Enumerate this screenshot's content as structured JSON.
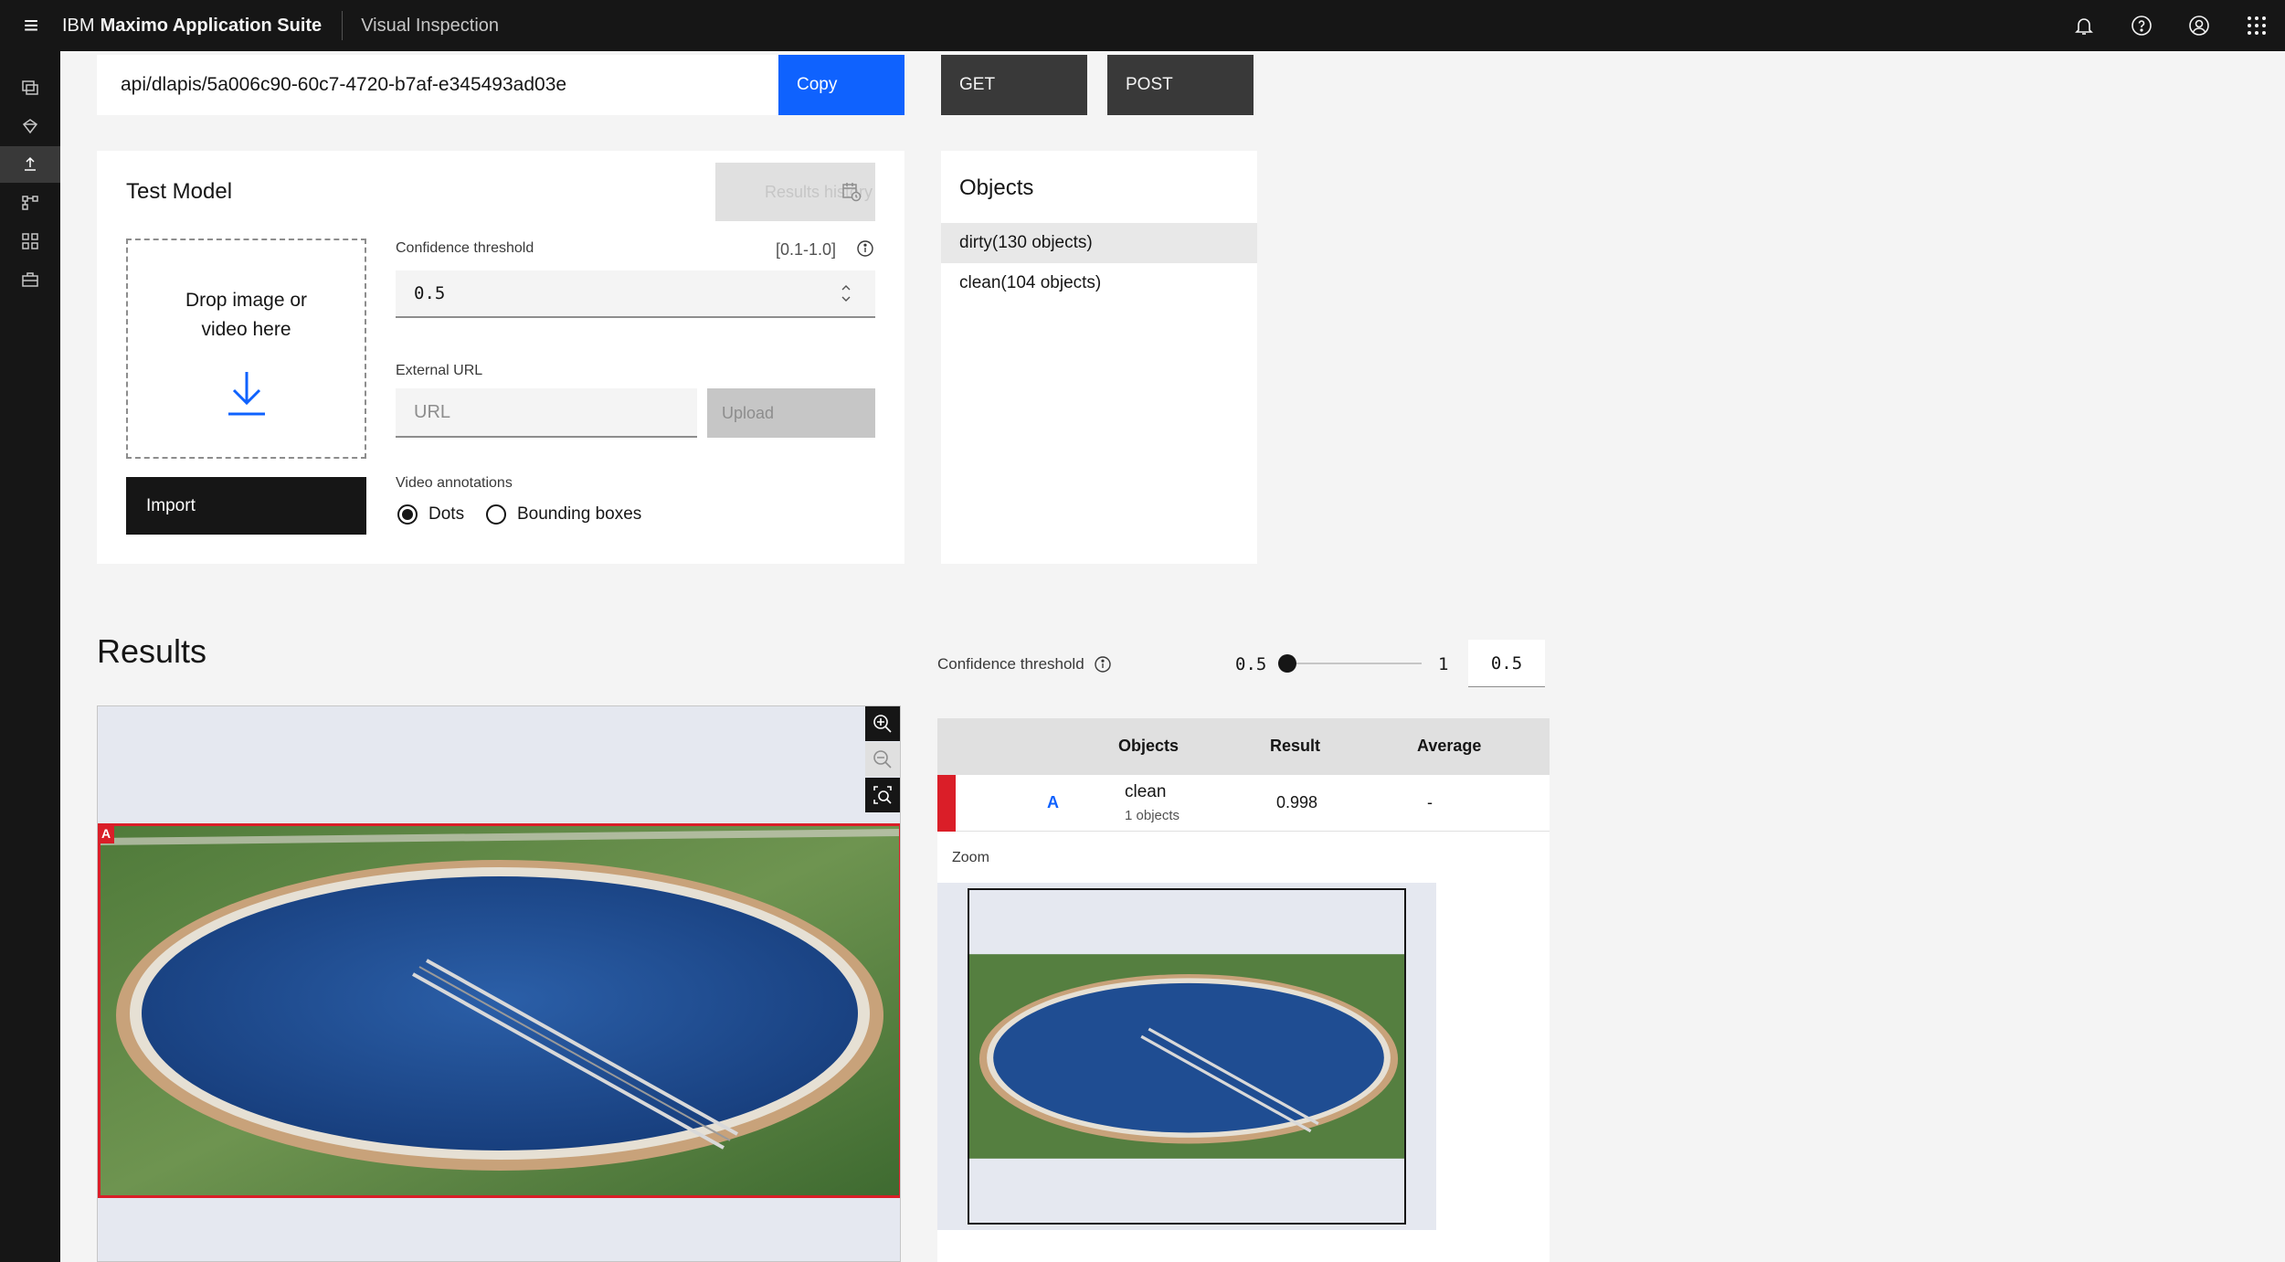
{
  "header": {
    "brand_prefix": "IBM",
    "brand_name": "Maximo Application Suite",
    "product": "Visual Inspection"
  },
  "endpoint": {
    "url": "api/dlapis/5a006c90-60c7-4720-b7af-e345493ad03e",
    "copy_label": "Copy",
    "get_label": "GET",
    "post_label": "POST"
  },
  "test_model": {
    "title": "Test Model",
    "results_history_label": "Results history",
    "drop_text": "Drop image or video here",
    "import_label": "Import",
    "confidence_label": "Confidence threshold",
    "confidence_range": "[0.1-1.0]",
    "confidence_value": "0.5",
    "external_url_label": "External URL",
    "url_placeholder": "URL",
    "upload_label": "Upload",
    "video_annotations_label": "Video annotations",
    "radio_dots": "Dots",
    "radio_boxes": "Bounding boxes",
    "selected_annotation": "Dots"
  },
  "objects": {
    "title": "Objects",
    "items": [
      {
        "label": "dirty(130 objects)"
      },
      {
        "label": "clean(104 objects)"
      }
    ]
  },
  "results": {
    "title": "Results",
    "box_tag": "A",
    "confidence_label": "Confidence threshold",
    "slider_min": "0.5",
    "slider_max": "1",
    "slider_value": "0.5",
    "columns": [
      "Objects",
      "Result",
      "Average"
    ],
    "rows": [
      {
        "tag": "A",
        "object": "clean",
        "count": "1 objects",
        "result": "0.998",
        "average": "-"
      }
    ],
    "zoom_label": "Zoom"
  },
  "colors": {
    "accent": "#0f62fe",
    "detection_box": "#da1e28",
    "header_bg": "#161616"
  }
}
